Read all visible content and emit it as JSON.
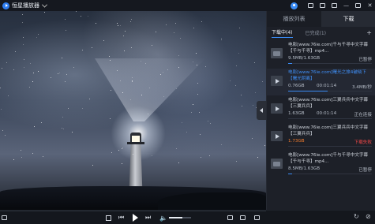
{
  "app": {
    "title": "恒星播放器"
  },
  "titlebar": {
    "icons": [
      "user-icon",
      "theme-icon",
      "pip-icon",
      "fullscreen-icon",
      "minimize-icon",
      "maximize-icon",
      "close-icon"
    ]
  },
  "panel": {
    "tabs": [
      {
        "label": "播放列表"
      },
      {
        "label": "下载"
      }
    ],
    "subtabs": [
      {
        "label": "下载中(4)"
      },
      {
        "label": "已完成(1)"
      }
    ],
    "add_label": "+",
    "items": [
      {
        "name": "电影[www.76ie.com]千与千寻中文字幕【千与千寻】mp4...",
        "size": "9.5MB/1.63GB",
        "time": "",
        "status": "已暂停",
        "status_color": "#b5bcc7",
        "progress": 0.05,
        "kind": "folder"
      },
      {
        "name": "电影[www.76ie.com]曙光之旅4破晓下【曙光阴离】",
        "size": "0.76GB",
        "time": "00:01:14",
        "status": "3.4MB/秒",
        "status_color": "#b5bcc7",
        "progress": 0.47,
        "kind": "video",
        "selected": true,
        "name_blue": true
      },
      {
        "name": "电影[www.76ie.com]三翼兵兵中文字幕【三翼兵兵】",
        "size": "1.63GB",
        "time": "00:01:14",
        "status": "正在连接",
        "status_color": "#b5bcc7",
        "progress": 0.0,
        "kind": "video"
      },
      {
        "name": "电影[www.76ie.com]三翼兵兵中文字幕【三翼兵兵】",
        "size": "1.73GB",
        "time": "",
        "status": "下载失败",
        "status_color": "#f04848",
        "progress": 0.0,
        "kind": "video",
        "size_orange": true
      },
      {
        "name": "电影[www.76ie.com]千与千寻中文字幕【千与千寻】mp4...",
        "size": "8.5MB/1.63GB",
        "time": "",
        "status": "已暂停",
        "status_color": "#b5bcc7",
        "progress": 0.05,
        "kind": "folder"
      }
    ]
  },
  "controls": {
    "icons": [
      "stop-icon",
      "prev-icon",
      "play-icon",
      "next-icon",
      "volume-icon",
      "screenshot-icon",
      "fullscreen-icon"
    ],
    "volume": 0.6
  }
}
